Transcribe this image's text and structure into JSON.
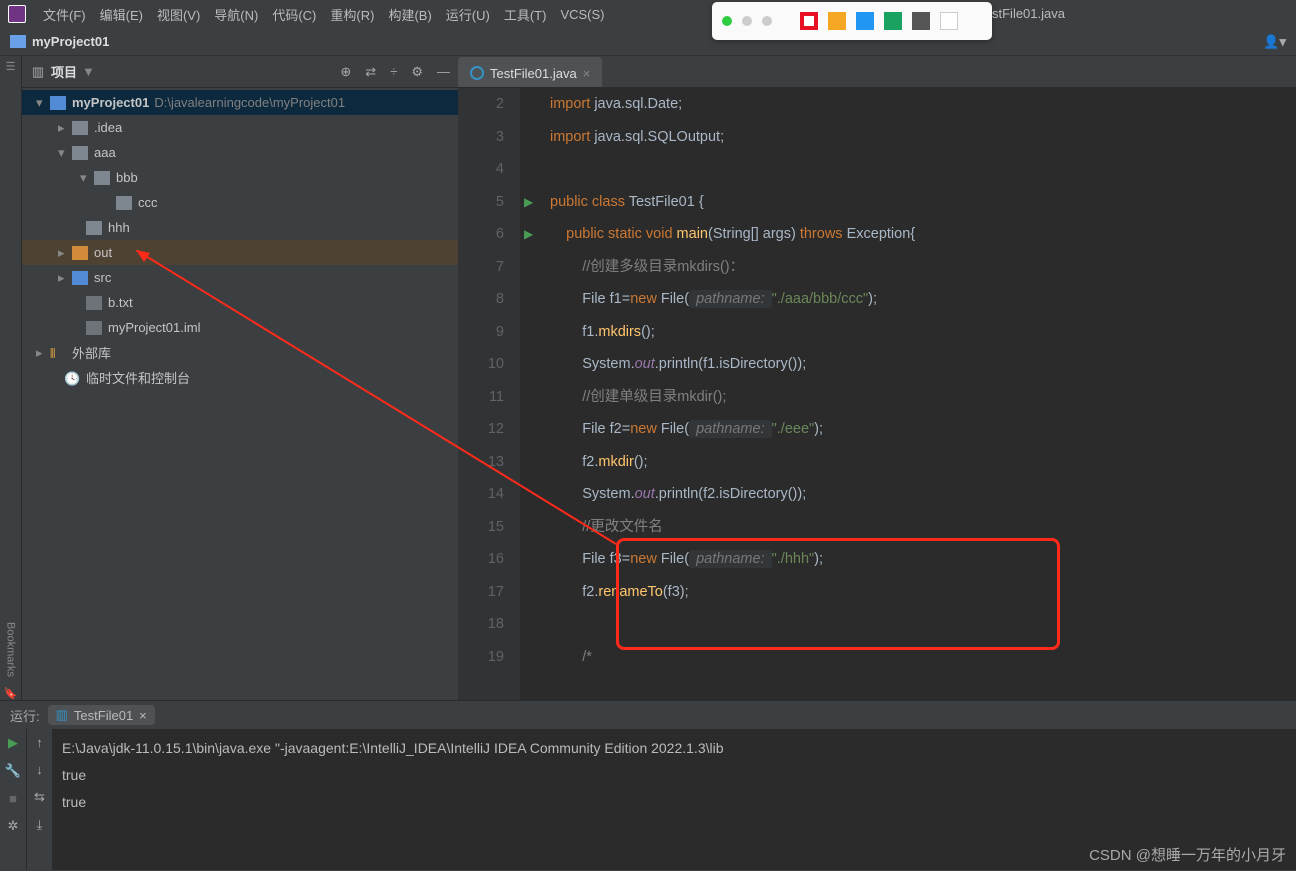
{
  "menu": {
    "items": [
      "文件(F)",
      "编辑(E)",
      "视图(V)",
      "导航(N)",
      "代码(C)",
      "重构(R)",
      "构建(B)",
      "运行(U)",
      "工具(T)",
      "VCS(S)"
    ]
  },
  "tabname_top": "stFile01.java",
  "appbar": {
    "project": "myProject01"
  },
  "sidebar": {
    "title": "项目",
    "tools": [
      "⊕",
      "⇄",
      "÷",
      "⚙",
      "—"
    ]
  },
  "tree": {
    "n0": {
      "arr": "▾",
      "label": "myProject01",
      "path": "D:\\javalearningcode\\myProject01"
    },
    "n1": {
      "arr": "▸",
      "label": ".idea"
    },
    "n2": {
      "arr": "▾",
      "label": "aaa"
    },
    "n3": {
      "arr": "▾",
      "label": "bbb"
    },
    "n4": {
      "arr": "",
      "label": "ccc"
    },
    "n5": {
      "arr": "",
      "label": "hhh"
    },
    "n6": {
      "arr": "▸",
      "label": "out"
    },
    "n7": {
      "arr": "▸",
      "label": "src"
    },
    "n8": {
      "arr": "",
      "label": "b.txt"
    },
    "n9": {
      "arr": "",
      "label": "myProject01.iml"
    },
    "n10": {
      "arr": "▸",
      "label": "外部库"
    },
    "n11": {
      "arr": "",
      "label": "临时文件和控制台"
    }
  },
  "editor": {
    "tab": "TestFile01.java",
    "lines": [
      "2",
      "3",
      "4",
      "5",
      "6",
      "7",
      "8",
      "9",
      "10",
      "11",
      "12",
      "13",
      "14",
      "15",
      "16",
      "17",
      "18",
      "19"
    ]
  },
  "code": {
    "l2": "import java.sql.Date;",
    "l3": "import java.sql.SQLOutput;",
    "l5a": "public class ",
    "l5b": "TestFile01 {",
    "l6a": "public static void ",
    "l6b": "main",
    "l6c": "(String[] args) ",
    "l6d": "throws ",
    "l6e": "Exception{",
    "l7": "//创建多级目录mkdirs()：",
    "l8a": "File f1=",
    "l8b": "new ",
    "l8c": "File(",
    "l8d": " pathname: ",
    "l8e": "\"./aaa/bbb/ccc\"",
    "l8f": ");",
    "l9a": "f1.",
    "l9b": "mkdirs",
    "l9c": "();",
    "l10a": "System.",
    "l10b": "out",
    "l10c": ".println(f1.isDirectory());",
    "l11": "//创建单级目录mkdir();",
    "l12a": "File f2=",
    "l12b": "new ",
    "l12c": "File(",
    "l12d": " pathname: ",
    "l12e": "\"./eee\"",
    "l12f": ");",
    "l13a": "f2.",
    "l13b": "mkdir",
    "l13c": "();",
    "l14a": "System.",
    "l14b": "out",
    "l14c": ".println(f2.isDirectory());",
    "l15": "//更改文件名",
    "l16a": "File f3=",
    "l16b": "new ",
    "l16c": "File(",
    "l16d": " pathname: ",
    "l16e": "\"./hhh\"",
    "l16f": ");",
    "l17a": "f2.",
    "l17b": "renameTo",
    "l17c": "(f3);",
    "l19": "/*"
  },
  "run": {
    "label": "运行:",
    "tab": "TestFile01",
    "out1": "E:\\Java\\jdk-11.0.15.1\\bin\\java.exe \"-javaagent:E:\\IntelliJ_IDEA\\IntelliJ IDEA Community Edition 2022.1.3\\lib",
    "out2": "true",
    "out3": "true"
  },
  "watermark": "CSDN @想睡一万年的小月牙"
}
